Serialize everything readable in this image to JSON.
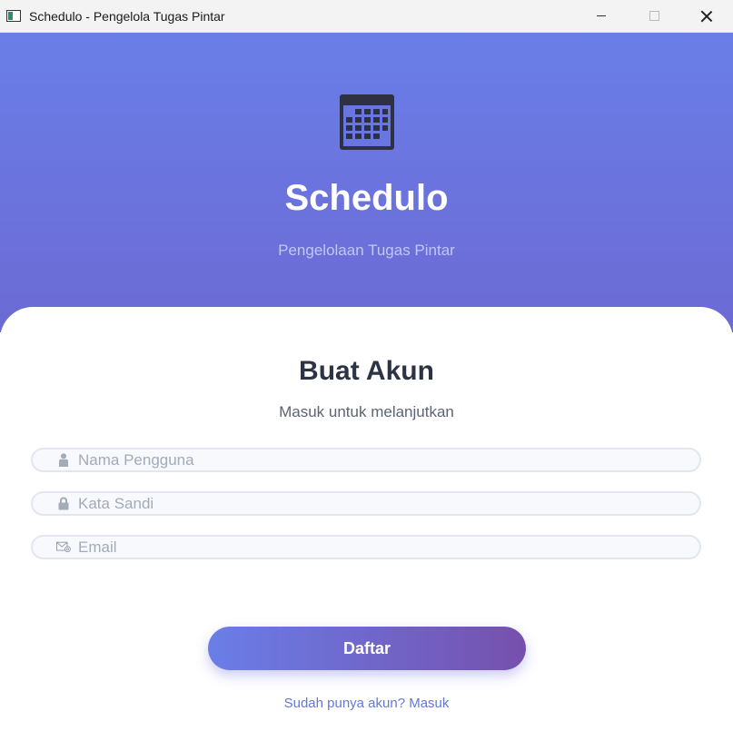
{
  "window": {
    "title": "Schedulo - Pengelola Tugas Pintar",
    "icon": "app-window-icon"
  },
  "hero": {
    "icon": "calendar-icon",
    "title": "Schedulo",
    "subtitle": "Pengelolaan Tugas Pintar",
    "gradient_top": "#6a7ee8",
    "gradient_bottom": "#6c6ad4"
  },
  "form": {
    "title": "Buat Akun",
    "subtitle": "Masuk untuk melanjutkan",
    "fields": [
      {
        "icon": "user-icon",
        "placeholder": "Nama Pengguna",
        "value": ""
      },
      {
        "icon": "lock-icon",
        "placeholder": "Kata Sandi",
        "value": ""
      },
      {
        "icon": "email-icon",
        "placeholder": "Email",
        "value": ""
      }
    ],
    "submit_label": "Daftar",
    "login_link": "Sudah punya akun? Masuk",
    "button_gradient_start": "#6a7ee8",
    "button_gradient_end": "#7650ad",
    "link_color": "#6478d8"
  }
}
